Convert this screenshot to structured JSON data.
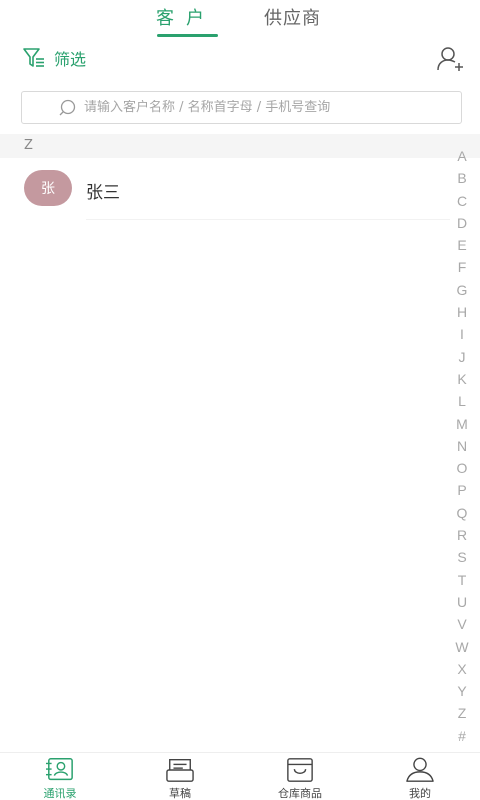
{
  "tabs": [
    {
      "label": "客户",
      "active": true
    },
    {
      "label": "供应商",
      "active": false
    }
  ],
  "toolbar": {
    "filter_label": "筛选",
    "filter_icon": "filter-icon",
    "add_icon": "add-user-icon"
  },
  "search": {
    "placeholder": "请输入客户名称 / 名称首字母 / 手机号查询",
    "value": ""
  },
  "sections": [
    {
      "letter": "Z",
      "contacts": [
        {
          "avatar_text": "张",
          "name": "张三",
          "avatar_color": "#c4999f"
        }
      ]
    }
  ],
  "alphabet": [
    "A",
    "B",
    "C",
    "D",
    "E",
    "F",
    "G",
    "H",
    "I",
    "J",
    "K",
    "L",
    "M",
    "N",
    "O",
    "P",
    "Q",
    "R",
    "S",
    "T",
    "U",
    "V",
    "W",
    "X",
    "Y",
    "Z",
    "#"
  ],
  "bottom_nav": [
    {
      "label": "通讯录",
      "icon": "contacts-icon",
      "active": true
    },
    {
      "label": "草稿",
      "icon": "draft-icon",
      "active": false
    },
    {
      "label": "仓库商品",
      "icon": "warehouse-icon",
      "active": false
    },
    {
      "label": "我的",
      "icon": "profile-icon",
      "active": false
    }
  ],
  "colors": {
    "accent": "#2aa16e",
    "avatar": "#c4999f"
  }
}
